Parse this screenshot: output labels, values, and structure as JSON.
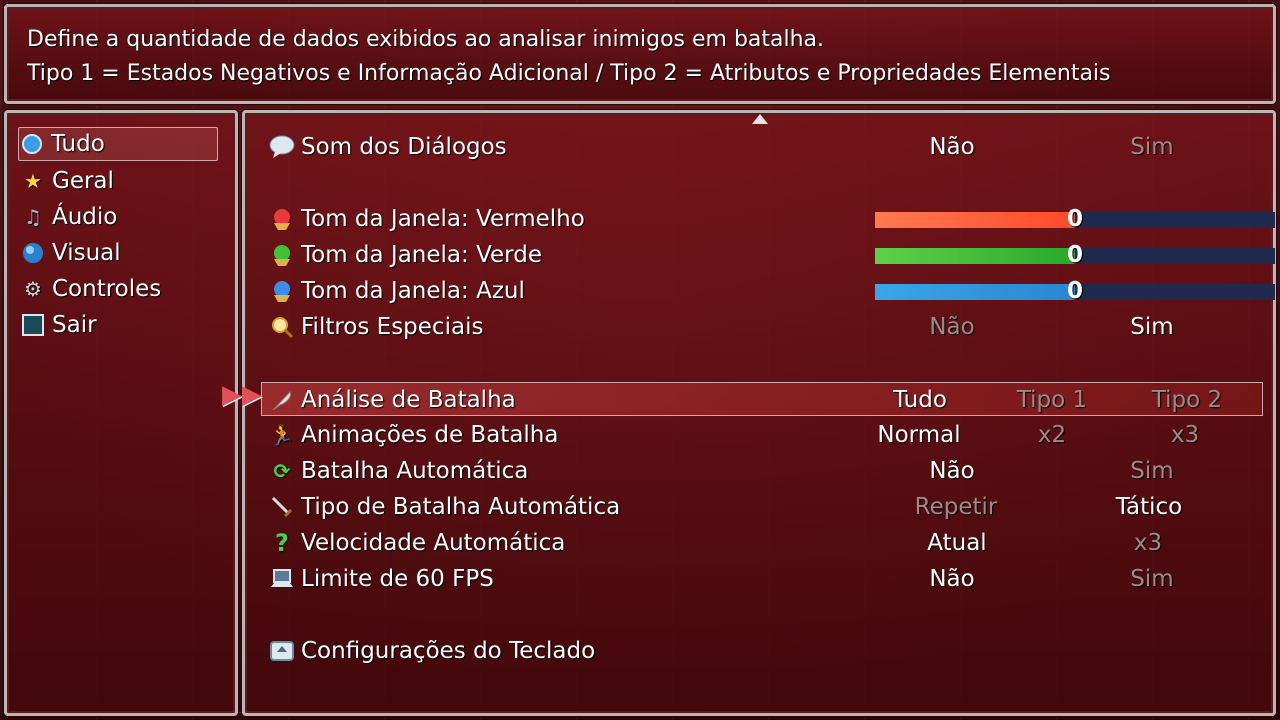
{
  "help": {
    "line1": "Define a quantidade de dados exibidos ao analisar inimigos em batalha.",
    "line2": "Tipo 1 = Estados Negativos e Informação Adicional / Tipo 2 = Atributos e Propriedades Elementais"
  },
  "sidebar": {
    "items": [
      {
        "label": "Tudo",
        "icon": "blue-orb-icon",
        "selected": true
      },
      {
        "label": "Geral",
        "icon": "star-icon"
      },
      {
        "label": "Áudio",
        "icon": "music-note-icon"
      },
      {
        "label": "Visual",
        "icon": "globe-icon"
      },
      {
        "label": "Controles",
        "icon": "gear-icon"
      },
      {
        "label": "Sair",
        "icon": "exit-square-icon"
      }
    ]
  },
  "options": {
    "voice": {
      "label": "Som dos Diálogos",
      "icon": "speech-bubble-icon",
      "opt1": "Não",
      "opt2": "Sim",
      "active": "Não"
    },
    "red": {
      "label": "Tom da Janela: Vermelho",
      "icon": "red-gem-icon",
      "value": "0",
      "color": "#ff5a3a"
    },
    "green": {
      "label": "Tom da Janela: Verde",
      "icon": "green-gem-icon",
      "value": "0",
      "color": "#3fbf2f"
    },
    "blue": {
      "label": "Tom da Janela: Azul",
      "icon": "blue-gem-icon",
      "value": "0",
      "color": "#2a9fe0"
    },
    "filters": {
      "label": "Filtros Especiais",
      "icon": "magnifier-icon",
      "opt1": "Não",
      "opt2": "Sim",
      "active": "Sim"
    },
    "analysis": {
      "label": "Análise de Batalha",
      "icon": "feather-icon",
      "opt1": "Tudo",
      "opt2": "Tipo 1",
      "opt3": "Tipo 2",
      "active": "Tudo"
    },
    "animations": {
      "label": "Animações de Batalha",
      "icon": "running-figure-icon",
      "opt1": "Normal",
      "opt2": "x2",
      "opt3": "x3",
      "active": "Normal"
    },
    "autobattle": {
      "label": "Batalha Automática",
      "icon": "cycle-arrows-icon",
      "opt1": "Não",
      "opt2": "Sim",
      "active": "Não"
    },
    "autotype": {
      "label": "Tipo de Batalha Automática",
      "icon": "sword-icon",
      "opt1": "Repetir",
      "opt2": "Tático",
      "active": "Tático"
    },
    "autospeed": {
      "label": "Velocidade Automática",
      "icon": "question-mark-icon",
      "opt1": "Atual",
      "opt2": "x3",
      "active": "Atual"
    },
    "fps": {
      "label": "Limite de 60 FPS",
      "icon": "laptop-icon",
      "opt1": "Não",
      "opt2": "Sim",
      "active": "Não"
    },
    "keyboard": {
      "label": "Configurações do Teclado",
      "icon": "keyboard-key-icon"
    }
  },
  "colors": {
    "accent_cursor": "#e2505a",
    "window_border": "#bdb4b4",
    "bar_track": "#1f2a4e"
  }
}
